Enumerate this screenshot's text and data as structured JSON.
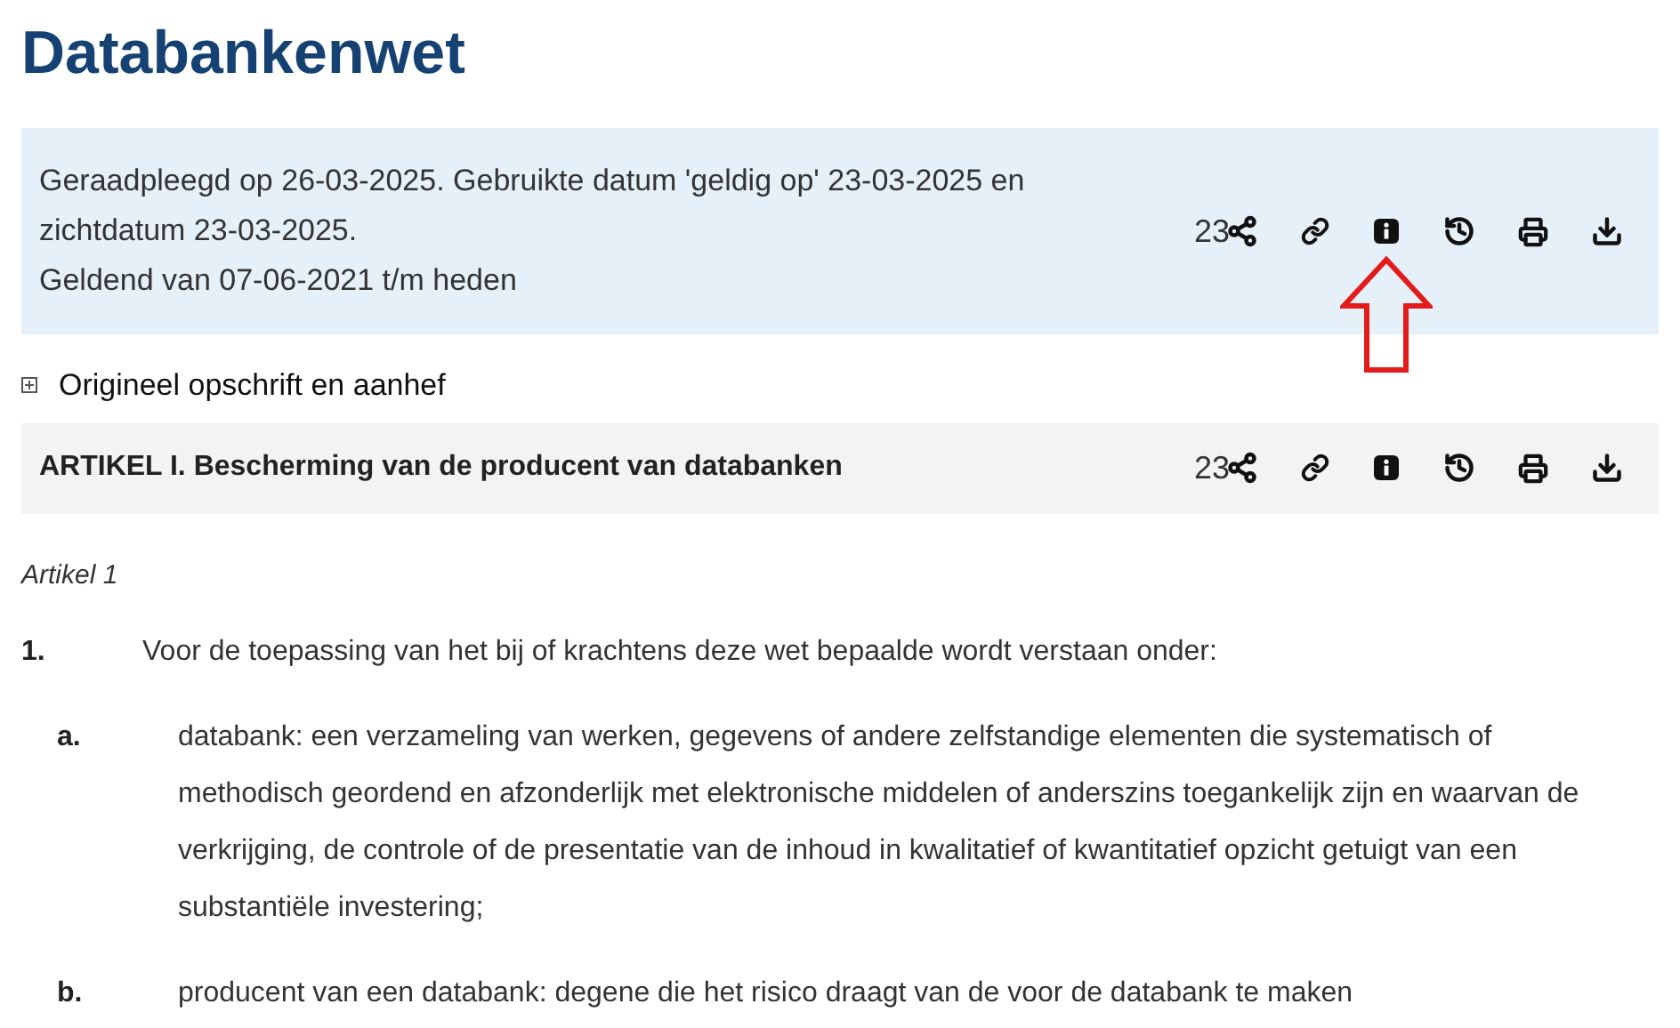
{
  "title": "Databankenwet",
  "info_panel": {
    "lines": [
      "Geraadpleegd op 26-03-2025. Gebruikte datum 'geldig op' 23-03-2025 en zichtdatum 23-03-2025.",
      "Geldend van 07-06-2021 t/m heden"
    ],
    "share_count": "23"
  },
  "collapsible": {
    "label": "Origineel opschrift en aanhef",
    "expanded": false
  },
  "section": {
    "heading": "ARTIKEL I. Bescherming van de producent van databanken",
    "share_count": "23"
  },
  "article": {
    "label": "Artikel 1",
    "items": [
      {
        "number": "1.",
        "text": "Voor de toepassing van het bij of krachtens deze wet bepaalde wordt verstaan onder:",
        "children": [
          {
            "number": "a.",
            "text": "databank: een verzameling van werken, gegevens of andere zelfstandige elementen die systematisch of methodisch geordend en afzonderlijk met elektronische middelen of anderszins toegankelijk zijn en waarvan de verkrijging, de controle of de presentatie van de inhoud in kwalitatief of kwantitatief opzicht getuigt van een substantiële investering;"
          },
          {
            "number": "b.",
            "text": "producent van een databank: degene die het risico draagt van de voor de databank te maken"
          }
        ]
      }
    ]
  }
}
